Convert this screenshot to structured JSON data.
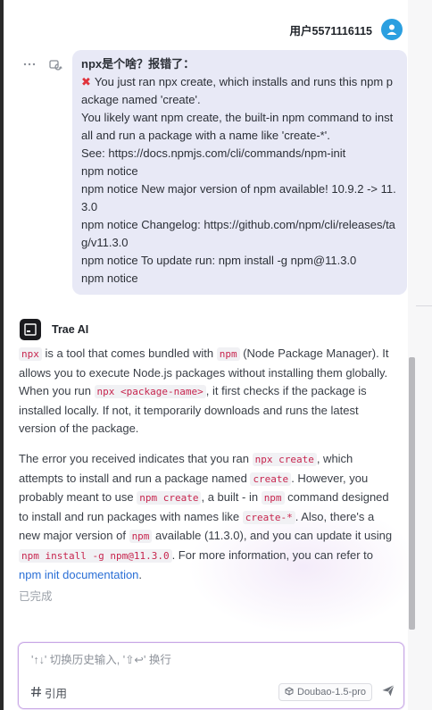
{
  "user": {
    "name": "用户5571116115"
  },
  "user_message": {
    "title": "npx是个啥？报错了：",
    "lines": [
      "You just ran npx create, which installs and runs this npm package named 'create'.",
      "You likely want npm create, the built-in npm command to install and run a package with a name like 'create-*'.",
      "See: https://docs.npmjs.com/cli/commands/npm-init",
      "npm notice",
      "npm notice New major version of npm available! 10.9.2 -> 11.3.0",
      "npm notice Changelog: https://github.com/npm/cli/releases/tag/v11.3.0",
      "npm notice To update run: npm install -g npm@11.3.0",
      "npm notice"
    ]
  },
  "assistant": {
    "name": "Trae AI",
    "p1": {
      "c1": "npx",
      "t1": " is a tool that comes bundled with ",
      "c2": "npm",
      "t2": " (Node Package Manager). It allows you to execute Node.js packages without installing them globally. When you run ",
      "c3": "npx <package-name>",
      "t3": ", it first checks if the package is installed locally. If not, it temporarily downloads and runs the latest version of the package."
    },
    "p2": {
      "t0": "The error you received indicates that you ran ",
      "c1": "npx create",
      "t1": ", which attempts to install and run a package named ",
      "c2": "create",
      "t2": ". However, you probably meant to use ",
      "c3": "npm create",
      "t3": ", a built - in ",
      "c4": "npm",
      "t4": " command designed to install and run packages with names like ",
      "c5": "create-*",
      "t5": ". Also, there's a new major version of ",
      "c6": "npm",
      "t6": " available (11.3.0), and you can update it using ",
      "c7": "npm install -g npm@11.3.0",
      "t7": ". For more information, you can refer to ",
      "link": "npm init documentation",
      "t8": "."
    },
    "status": "已完成"
  },
  "input": {
    "placeholder": "'↑↓' 切换历史输入, '⇧↩' 换行",
    "ref_label": "引用",
    "model": "Doubao-1.5-pro"
  },
  "colors": {
    "accent": "#2b9fe0",
    "bubble": "#e8e9f6",
    "link": "#2a6fd6",
    "code": "#c7254e",
    "error": "#e0333d"
  },
  "icons": [
    "more-icon",
    "retry-icon",
    "user-avatar-icon",
    "trae-logo-icon",
    "hash-icon",
    "cube-icon",
    "send-icon",
    "cross-icon"
  ]
}
